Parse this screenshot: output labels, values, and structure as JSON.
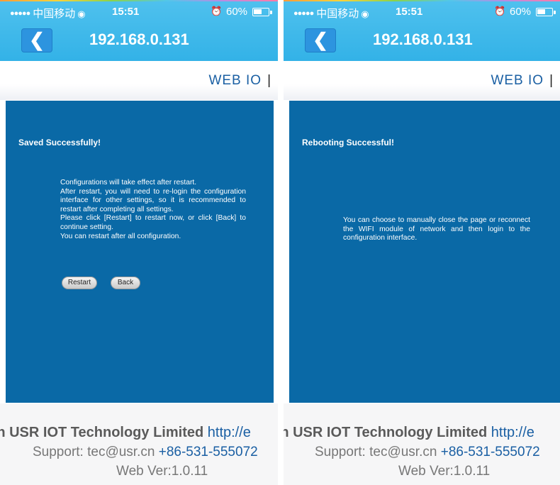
{
  "status_bar": {
    "signal_dots": "●●●●●",
    "carrier": "中国移动",
    "wifi_icon": "wifi-icon",
    "time": "15:51",
    "alarm_icon": "alarm-icon",
    "battery": "60%",
    "battery_level": 0.6
  },
  "nav": {
    "back_symbol": "❮",
    "title": "192.168.0.131"
  },
  "header": {
    "menu_label": "WEB IO",
    "separator": "|"
  },
  "screens": [
    {
      "title": "Saved Successfully!",
      "message_lines": [
        "Configurations will take effect after restart.",
        "After restart, you will need to re-login the configuration interface for other settings, so it is recommended to restart after completing all settings.",
        "Please click [Restart] to restart now, or click [Back] to continue setting.",
        "You can restart after all configuration."
      ],
      "restart_label": "Restart",
      "back_label": "Back"
    },
    {
      "title": "Rebooting Successful!",
      "message_lines": [
        "You can choose to manually close the page or reconnect the WIFI module of network and then login to the configuration interface."
      ]
    }
  ],
  "footer": {
    "company": "nan USR IOT Technology Limited",
    "url": "http://e",
    "support_label": "Support: tec@usr.cn",
    "phone": "+86-531-555072",
    "version": "Web Ver:1.0.11"
  },
  "colors": {
    "nav_bar": "#33b2e7",
    "panel": "#0a69a6",
    "link": "#1a5fa3"
  }
}
